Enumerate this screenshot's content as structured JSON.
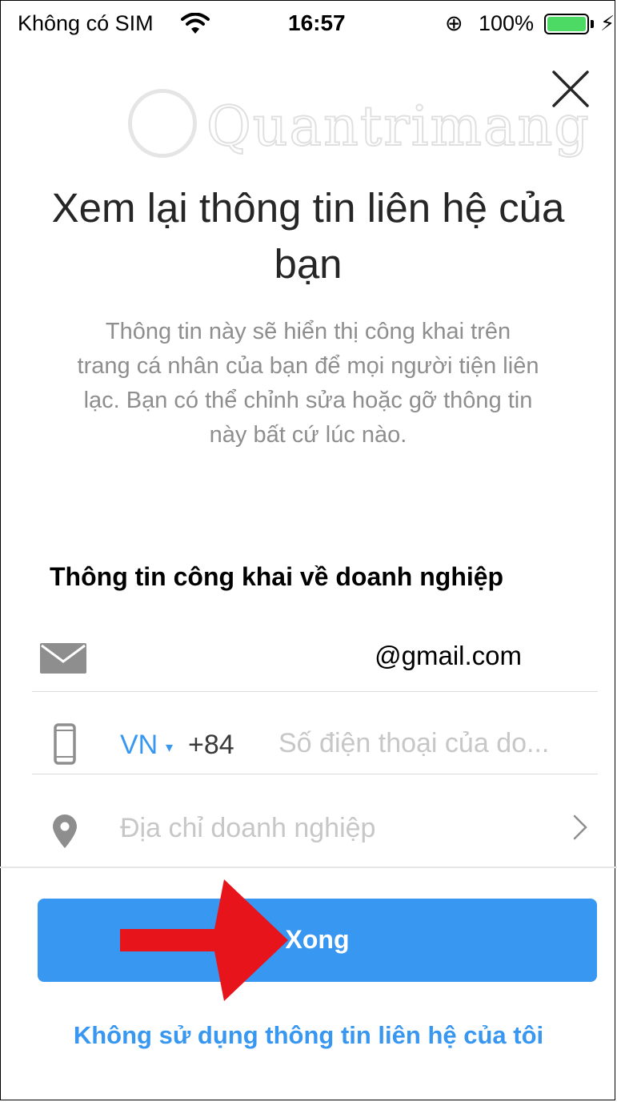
{
  "status_bar": {
    "carrier": "Không có SIM",
    "time": "16:57",
    "lock_icon": "rotation-lock-icon",
    "battery_percent": "100%",
    "battery_level": 1.0,
    "battery_color": "#4cd964"
  },
  "watermark": {
    "text": "Quantrimang"
  },
  "header": {
    "close_icon": "close-icon",
    "title": "Xem lại thông tin liên hệ của bạn",
    "description": "Thông tin này sẽ hiển thị công khai trên trang cá nhân của bạn để mọi người tiện liên lạc. Bạn có thể chỉnh sửa hoặc gỡ thông tin này bất cứ lúc nào."
  },
  "section": {
    "title": "Thông tin công khai về doanh nghiệp"
  },
  "fields": {
    "email": {
      "icon": "mail-icon",
      "value": "@gmail.com"
    },
    "phone": {
      "icon": "phone-icon",
      "country": "VN",
      "country_caret": "▾",
      "dial_code": "+84",
      "placeholder": "Số điện thoại của do...",
      "value": ""
    },
    "address": {
      "icon": "location-pin-icon",
      "placeholder": "Địa chỉ doanh nghiệp",
      "chevron_icon": "chevron-right-icon"
    }
  },
  "actions": {
    "done_label": "Xong",
    "skip_label": "Không sử dụng thông tin liên hệ của tôi"
  },
  "colors": {
    "accent": "#3897f0",
    "annotation_arrow": "#e8141b"
  }
}
